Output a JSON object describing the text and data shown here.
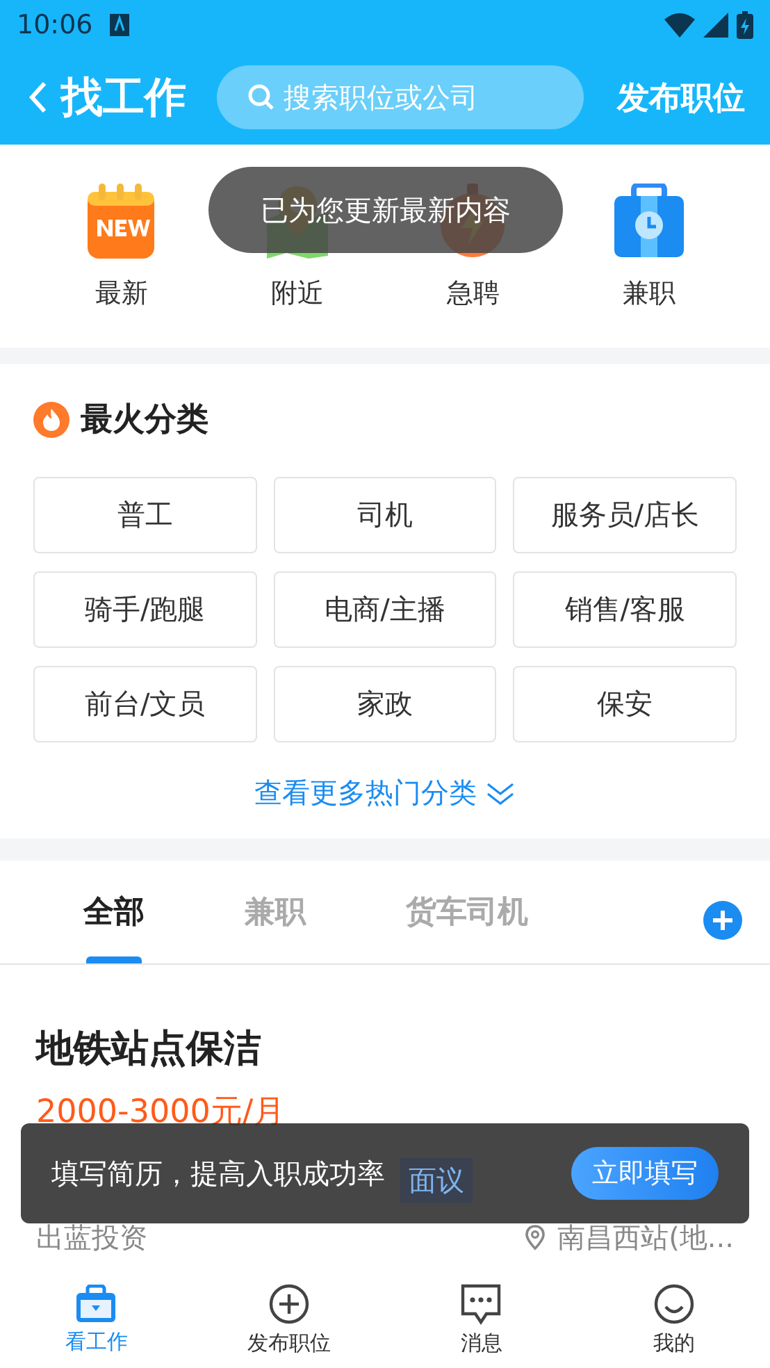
{
  "status_bar": {
    "time": "10:06"
  },
  "header": {
    "title": "找工作",
    "search": {
      "placeholder": "搜索职位或公司"
    },
    "action": "发布职位"
  },
  "quick_links": [
    {
      "kind": "new",
      "label": "最新"
    },
    {
      "kind": "nearby",
      "label": "附近"
    },
    {
      "kind": "urgent",
      "label": "急聘"
    },
    {
      "kind": "parttime",
      "label": "兼职"
    }
  ],
  "toast": "已为您更新最新内容",
  "hot_categories": {
    "title": "最火分类",
    "items": [
      "普工",
      "司机",
      "服务员/店长",
      "骑手/跑腿",
      "电商/主播",
      "销售/客服",
      "前台/文员",
      "家政",
      "保安"
    ],
    "more": "查看更多热门分类"
  },
  "tabs": [
    {
      "label": "全部",
      "selected": true
    },
    {
      "label": "兼职",
      "selected": false
    },
    {
      "label": "货车司机",
      "selected": false
    }
  ],
  "job": {
    "title": "地铁站点保洁",
    "salary": "2000-3000元/月",
    "tags": [
      "面议"
    ],
    "company": "出蓝投资",
    "location": "南昌西站(地..."
  },
  "banner": {
    "text": "填写简历，提高入职成功率",
    "button": "立即填写"
  },
  "bottom_nav": [
    {
      "kind": "jobs",
      "label": "看工作",
      "selected": true
    },
    {
      "kind": "post",
      "label": "发布职位",
      "selected": false
    },
    {
      "kind": "messages",
      "label": "消息",
      "selected": false
    },
    {
      "kind": "me",
      "label": "我的",
      "selected": false
    }
  ]
}
